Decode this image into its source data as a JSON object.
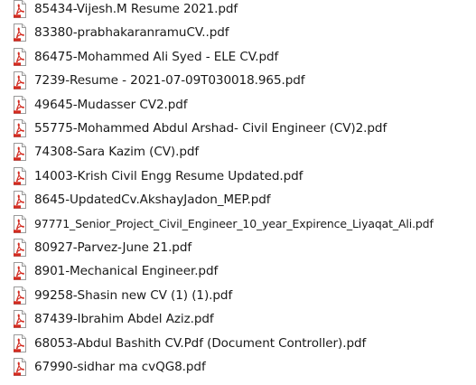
{
  "icon": "pdf-file-icon",
  "colors": {
    "icon_red": "#d32a1f",
    "text": "#1a1a1a",
    "background": "#ffffff"
  },
  "files": [
    "85434-Vijesh.M Resume 2021.pdf",
    "83380-prabhakaranramuCV..pdf",
    "86475-Mohammed Ali Syed - ELE CV.pdf",
    "7239-Resume - 2021-07-09T030018.965.pdf",
    "49645-Mudasser CV2.pdf",
    "55775-Mohammed Abdul Arshad- Civil Engineer (CV)2.pdf",
    "74308-Sara Kazim (CV).pdf",
    "14003-Krish Civil Engg Resume Updated.pdf",
    "8645-UpdatedCv.AkshayJadon_MEP.pdf",
    "97771_Senior_Project_Civil_Engineer_10_year_Expirence_Liyaqat_Ali.pdf",
    "80927-Parvez-June 21.pdf",
    "8901-Mechanical Engineer.pdf",
    "99258-Shasin new CV (1) (1).pdf",
    "87439-Ibrahim Abdel Aziz.pdf",
    "68053-Abdul Bashith CV.Pdf (Document Controller).pdf",
    "67990-sidhar ma cvQG8.pdf"
  ]
}
